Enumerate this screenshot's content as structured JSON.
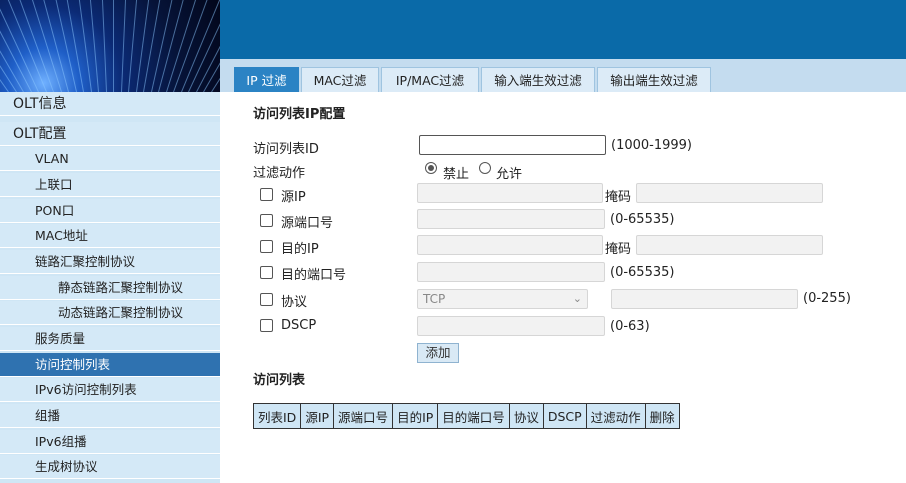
{
  "colors": {
    "header": "#0a6aa8",
    "tab_active": "#2b83c4",
    "sidebar_active": "#2f72b0",
    "sidebar_bg": "#d4e9f7"
  },
  "tabs": [
    "IP 过滤",
    "MAC过滤",
    "IP/MAC过滤",
    "输入端生效过滤",
    "输出端生效过滤"
  ],
  "sidebar": [
    {
      "label": "OLT信息"
    },
    {
      "label": "OLT配置"
    },
    {
      "label": "VLAN"
    },
    {
      "label": "上联口"
    },
    {
      "label": "PON口"
    },
    {
      "label": "MAC地址"
    },
    {
      "label": "链路汇聚控制协议"
    },
    {
      "label": "静态链路汇聚控制协议"
    },
    {
      "label": "动态链路汇聚控制协议"
    },
    {
      "label": "服务质量"
    },
    {
      "label": "访问控制列表"
    },
    {
      "label": "IPv6访问控制列表"
    },
    {
      "label": "组播"
    },
    {
      "label": "IPv6组播"
    },
    {
      "label": "生成树协议"
    }
  ],
  "form": {
    "title": "访问列表IP配置",
    "acl_id_label": "访问列表ID",
    "acl_id_value": "",
    "acl_id_range": "(1000-1999)",
    "action_label": "过滤动作",
    "action_deny": "禁止",
    "action_allow": "允许",
    "src_ip_label": "源IP",
    "mask_label": "掩码",
    "src_port_label": "源端口号",
    "port_range": "(0-65535)",
    "dst_ip_label": "目的IP",
    "dst_port_label": "目的端口号",
    "protocol_label": "协议",
    "protocol_value": "TCP",
    "protocol_range": "(0-255)",
    "dscp_label": "DSCP",
    "dscp_range": "(0-63)",
    "add_button": "添加"
  },
  "list": {
    "title": "访问列表",
    "columns": [
      "列表ID",
      "源IP",
      "源端口号",
      "目的IP",
      "目的端口号",
      "协议",
      "DSCP",
      "过滤动作",
      "删除"
    ]
  }
}
